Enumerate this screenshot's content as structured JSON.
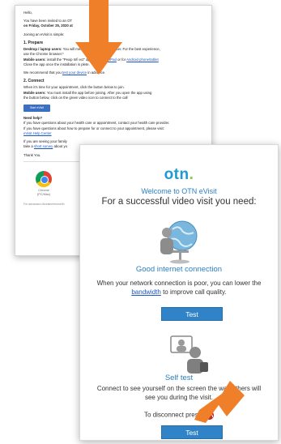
{
  "email": {
    "greeting": "Hello,",
    "intro_a": "You have been invited to an OT",
    "intro_b": "on Friday, October 25, 2020 at",
    "intro_c": "Joining an eVisit is simple:",
    "prepare_heading": "1. Prepare",
    "prepare_desktop_label": "Desktop / laptop users:",
    "prepare_desktop_a": "You will",
    "prepare_desktop_b": "ment using your web browser. For the best experience,",
    "prepare_desktop_c": "use the Chrome browser.*",
    "prepare_mobile_label": "Mobile users:",
    "prepare_mobile_a": "install the \"Pexip Infi",
    "prepare_mobile_b": "ect\" app for",
    "prepare_mobile_ios": "iPhone/iPad",
    "prepare_mobile_or": "or for",
    "prepare_mobile_android": "Android phone/tablet",
    "prepare_mobile_c": "Close the app once the installation is",
    "prepare_mobile_d": "plete.",
    "recommend_a": "We recommend that you",
    "recommend_link": "test your device",
    "recommend_b": "in advance.",
    "connect_heading": "2. Connect",
    "connect_desktop": "When it's time for your appointment, click the button below to join.",
    "connect_mobile_label": "Mobile users:",
    "connect_mobile_a": "You must install the app before joining. After you open the app using",
    "connect_mobile_b": "the button below, click on the green video icon to connect to the call",
    "join_button": "Start eVisit",
    "help_heading": "Need help?",
    "help_a": "If you have questions about your health care or appointment, contact your health care provider.",
    "help_b": "If you have questions about how to prepare for or connect to your appointment, please visit:",
    "help_link": "eVisit Help Center",
    "family_a": "If you are seeing your family",
    "family_b": "take a",
    "family_link": "short survey",
    "family_c": "about yo",
    "thanks": "Thank You.",
    "support_note": "*Your eVisit w",
    "browser_name": "Chrome",
    "browser_platform": "(PC/Mac)",
    "footer": "For advanced /dizzaine/ers/se/th"
  },
  "panel": {
    "logo_text": "otn",
    "logo_dot": ".",
    "welcome": "Welcome to OTN eVisit",
    "headline": "For a successful video visit you need:",
    "section1_title": "Good internet connection",
    "section1_text_a": "When your network connection is poor, you can lower the",
    "section1_link": "bandwidth",
    "section1_text_b": "to improve call quality.",
    "section1_button": "Test",
    "section2_title": "Self test",
    "section2_text": "Connect to see yourself on the screen the way others will see you during the visit.",
    "disconnect_text": "To disconnect press",
    "section2_button": "Test"
  },
  "colors": {
    "arrow": "#f07f2a",
    "otn_blue": "#1c9ad6",
    "otn_green": "#8cc63f",
    "button_blue": "#2f83c6",
    "hangup_red": "#c62828"
  }
}
